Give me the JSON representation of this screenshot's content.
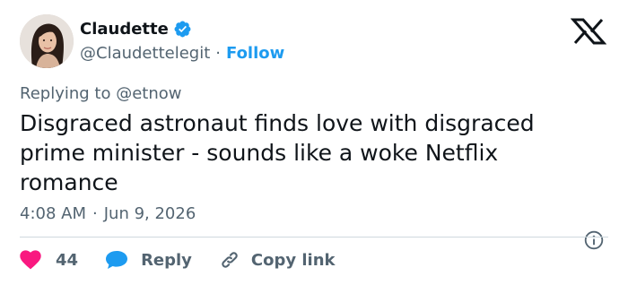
{
  "tweet": {
    "author": {
      "display_name": "Claudette",
      "handle": "@Claudettelegit",
      "verified": true,
      "follow_label": "Follow",
      "separator": "·"
    },
    "logo": "x-logo",
    "replying_to_prefix": "Replying to",
    "replying_to_handle": "@etnow",
    "text": "Disgraced astronaut finds love with disgraced prime minister - sounds like a woke Netflix romance",
    "time": "4:08 AM",
    "date_separator": "·",
    "date": "Jun 9, 2026",
    "actions": {
      "like_count": "44",
      "reply_label": "Reply",
      "copy_link_label": "Copy link"
    }
  },
  "colors": {
    "accent": "#1d9bf0",
    "like": "#f91880",
    "text_primary": "#0f1419",
    "text_secondary": "#536471",
    "divider": "#cfd9de"
  },
  "icons": [
    "verified-badge-icon",
    "x-logo-icon",
    "info-icon",
    "heart-icon",
    "reply-bubble-icon",
    "link-icon"
  ]
}
